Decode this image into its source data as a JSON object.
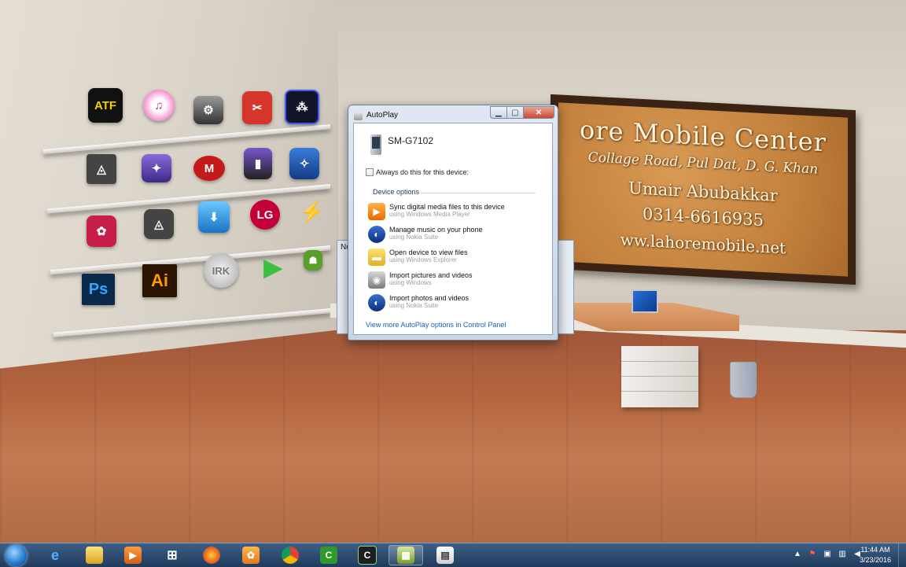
{
  "desktop": {
    "board": {
      "line1": "ore Mobile Center",
      "line2": "Collage Road, Pul Dat, D. G. Khan",
      "line3": "Umair Abubakkar",
      "line4": "0314-6616935",
      "line5": "ww.lahoremobile.net"
    },
    "icons": {
      "atf": "ATF",
      "ps": "Ps",
      "ai": "Ai",
      "irk": "IRK",
      "lg": "LG"
    },
    "background_window_title": "No"
  },
  "dialog": {
    "title": "AutoPlay",
    "device_name": "SM-G7102",
    "always_do_label": "Always do this for this device:",
    "always_do_checked": false,
    "section_heading": "Device options",
    "options": [
      {
        "main": "Sync digital media files to this device",
        "sub": "using Windows Media Player",
        "icon": "windows-media-player-icon"
      },
      {
        "main": "Manage music on your phone",
        "sub": "using Nokia Suite",
        "icon": "nokia-suite-icon"
      },
      {
        "main": "Open device to view files",
        "sub": "using Windows Explorer",
        "icon": "folder-icon"
      },
      {
        "main": "Import pictures and videos",
        "sub": "using Windows",
        "icon": "camera-icon"
      },
      {
        "main": "Import photos and videos",
        "sub": "using Nokia Suite",
        "icon": "nokia-suite-icon"
      }
    ],
    "control_panel_link": "View more AutoPlay options in Control Panel"
  },
  "taskbar": {
    "clock_time": "11:44 AM",
    "clock_date": "3/23/2016",
    "active_item": "taskbar-item-7"
  }
}
